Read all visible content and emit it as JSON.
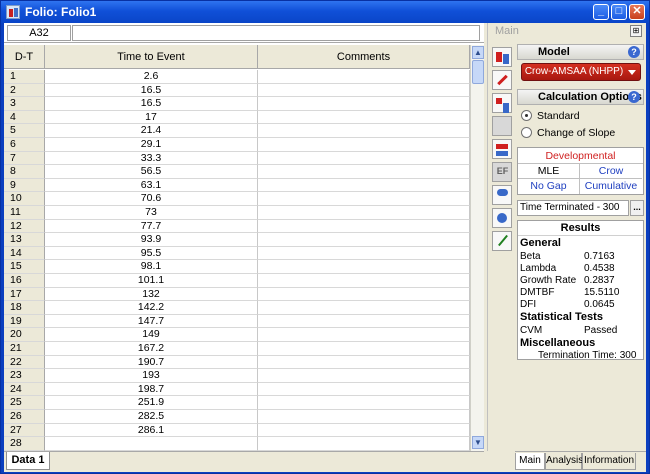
{
  "window": {
    "title": "Folio: Folio1",
    "minimize": "_",
    "maximize": "□",
    "close": "✕"
  },
  "cell_ref": "A32",
  "columns": [
    "D-T",
    "Time to Event",
    "Comments"
  ],
  "rows": [
    {
      "n": "1",
      "t": "2.6"
    },
    {
      "n": "2",
      "t": "16.5"
    },
    {
      "n": "3",
      "t": "16.5"
    },
    {
      "n": "4",
      "t": "17"
    },
    {
      "n": "5",
      "t": "21.4"
    },
    {
      "n": "6",
      "t": "29.1"
    },
    {
      "n": "7",
      "t": "33.3"
    },
    {
      "n": "8",
      "t": "56.5"
    },
    {
      "n": "9",
      "t": "63.1"
    },
    {
      "n": "10",
      "t": "70.6"
    },
    {
      "n": "11",
      "t": "73"
    },
    {
      "n": "12",
      "t": "77.7"
    },
    {
      "n": "13",
      "t": "93.9"
    },
    {
      "n": "14",
      "t": "95.5"
    },
    {
      "n": "15",
      "t": "98.1"
    },
    {
      "n": "16",
      "t": "101.1"
    },
    {
      "n": "17",
      "t": "132"
    },
    {
      "n": "18",
      "t": "142.2"
    },
    {
      "n": "19",
      "t": "147.7"
    },
    {
      "n": "20",
      "t": "149"
    },
    {
      "n": "21",
      "t": "167.2"
    },
    {
      "n": "22",
      "t": "190.7"
    },
    {
      "n": "23",
      "t": "193"
    },
    {
      "n": "24",
      "t": "198.7"
    },
    {
      "n": "25",
      "t": "251.9"
    },
    {
      "n": "26",
      "t": "282.5"
    },
    {
      "n": "27",
      "t": "286.1"
    },
    {
      "n": "28",
      "t": ""
    }
  ],
  "sheet_tab": "Data 1",
  "icons": [
    "bar-chart-icon",
    "line-plot-icon",
    "calc-icon",
    "data-icon",
    "transfer-icon",
    "ef-icon",
    "filter-icon",
    "mirror-icon",
    "plot-icon"
  ],
  "panel": {
    "title": "Main",
    "pin": "⊞",
    "model_header": "Model",
    "model_value": "Crow-AMSAA (NHPP)",
    "calc_header": "Calculation Options",
    "radio_standard": "Standard",
    "radio_change": "Change of Slope",
    "developmental": "Developmental",
    "mle": "MLE",
    "crow": "Crow",
    "no_gap": "No Gap",
    "cumulative": "Cumulative",
    "time_terminated": "Time Terminated - 300",
    "ellipsis": "...",
    "help": "?"
  },
  "results": {
    "title": "Results",
    "general": "General",
    "beta_lbl": "Beta",
    "beta_val": "0.7163",
    "lambda_lbl": "Lambda",
    "lambda_val": "0.4538",
    "growth_lbl": "Growth Rate",
    "growth_val": "0.2837",
    "dmtbf_lbl": "DMTBF",
    "dmtbf_val": "15.5110",
    "dfi_lbl": "DFI",
    "dfi_val": "0.0645",
    "stat_tests": "Statistical Tests",
    "cvm_lbl": "CVM",
    "cvm_val": "Passed",
    "misc": "Miscellaneous",
    "term_time": "Termination Time: 300"
  },
  "panel_tabs": [
    "Main",
    "Analysis",
    "Information"
  ],
  "colors": {
    "titlebar": "#0a45c8",
    "model_dropdown": "#c02418",
    "developmental": "#d02020",
    "link_blue": "#2040c0"
  }
}
